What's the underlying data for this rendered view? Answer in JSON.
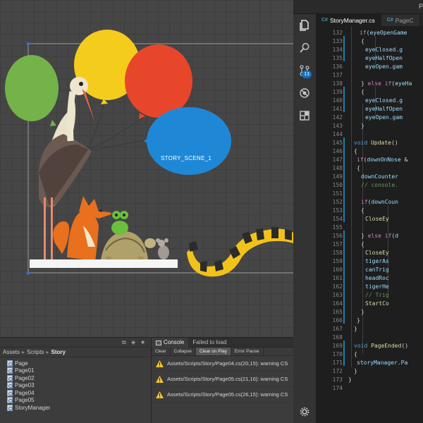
{
  "scene": {
    "label": "STORY_SCENE_1",
    "colors": {
      "balloon_green": "#74b24a",
      "balloon_yellow": "#f4cc1c",
      "balloon_red": "#e8462b",
      "balloon_blue": "#1e88d7",
      "fox": "#e8701e",
      "stork_body": "#e9e2c8",
      "grid_bg": "#464646"
    }
  },
  "project": {
    "breadcrumb": [
      "Assets",
      "Scripts",
      "Story"
    ],
    "files": [
      "Page",
      "Page01",
      "Page02",
      "Page03",
      "Page04",
      "Page05",
      "StoryManager"
    ],
    "icons": [
      "filter-icon",
      "tag-icon",
      "star-icon"
    ]
  },
  "console": {
    "tabs": [
      "Console",
      "Failed to load"
    ],
    "toolbar": [
      "Clear",
      "Collapse",
      "Clear on Play",
      "Error Pause"
    ],
    "logs": [
      "Assets/Scripts/Story/Page04.cs(20,15): warning CS",
      "Assets/Scripts/Story/Page05.cs(21,16): warning CS",
      "Assets/Scripts/Story/Page05.cs(26,15): warning CS"
    ],
    "warning_color": "#f2c230"
  },
  "vscode": {
    "title": "Pa",
    "tabs": [
      "StoryManager.cs",
      "PageC"
    ],
    "badge": "13",
    "activity_icons": [
      "files-icon",
      "search-icon",
      "source-control-icon",
      "debug-icon",
      "extensions-icon",
      "gear-icon"
    ],
    "lines": [
      {
        "n": "132",
        "t": "if(eyeOpenGame"
      },
      {
        "n": "133",
        "t": "{"
      },
      {
        "n": "134",
        "t": "eyeClosed.g"
      },
      {
        "n": "135",
        "t": "eyeHalfOpen"
      },
      {
        "n": "136",
        "t": "eyeOpen.gam"
      },
      {
        "n": "137",
        "t": ""
      },
      {
        "n": "138",
        "t": "} else if(eyeHa"
      },
      {
        "n": "139",
        "t": "{"
      },
      {
        "n": "140",
        "t": "eyeClosed.g"
      },
      {
        "n": "141",
        "t": "eyeHalfOpen"
      },
      {
        "n": "142",
        "t": "eyeOpen.gam"
      },
      {
        "n": "143",
        "t": "}"
      },
      {
        "n": "144",
        "t": ""
      },
      {
        "n": "145",
        "t": "void Update()"
      },
      {
        "n": "146",
        "t": "{"
      },
      {
        "n": "147",
        "t": "if(downOnNose &"
      },
      {
        "n": "148",
        "t": "{"
      },
      {
        "n": "149",
        "t": "downCounter"
      },
      {
        "n": "150",
        "t": "// console."
      },
      {
        "n": "151",
        "t": ""
      },
      {
        "n": "152",
        "t": "if(downCoun"
      },
      {
        "n": "153",
        "t": "{"
      },
      {
        "n": "154",
        "t": "CloseEy"
      },
      {
        "n": "155",
        "t": ""
      },
      {
        "n": "156",
        "t": "} else if(d"
      },
      {
        "n": "157",
        "t": "{"
      },
      {
        "n": "158",
        "t": "CloseEy"
      },
      {
        "n": "159",
        "t": "tigerAs"
      },
      {
        "n": "160",
        "t": "canTrig"
      },
      {
        "n": "161",
        "t": "headRoc"
      },
      {
        "n": "162",
        "t": "tigerHe"
      },
      {
        "n": "163",
        "t": "// Trig"
      },
      {
        "n": "164",
        "t": "StartCo"
      },
      {
        "n": "165",
        "t": "}"
      },
      {
        "n": "166",
        "t": "}"
      },
      {
        "n": "167",
        "t": "}"
      },
      {
        "n": "168",
        "t": ""
      },
      {
        "n": "169",
        "t": "void PageEnded()"
      },
      {
        "n": "170",
        "t": "{"
      },
      {
        "n": "171",
        "t": "storyManager.Pa"
      },
      {
        "n": "172",
        "t": "}"
      },
      {
        "n": "173",
        "t": "}"
      },
      {
        "n": "174",
        "t": ""
      }
    ]
  }
}
